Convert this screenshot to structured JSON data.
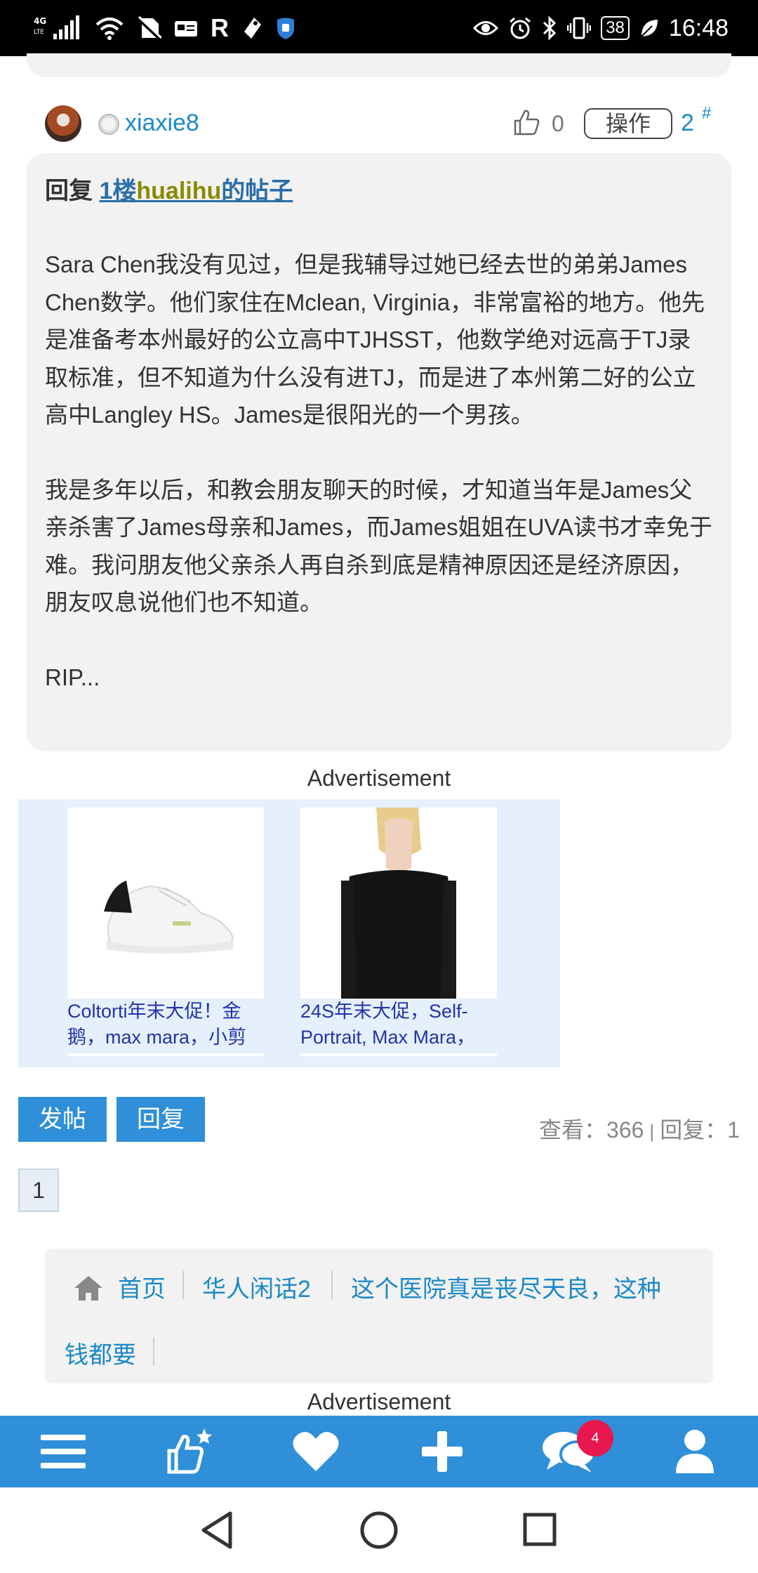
{
  "status_bar": {
    "network": "4G LTE",
    "time": "16:48",
    "battery": "38",
    "r_indicator": "R",
    "icons": [
      "signal-icon",
      "wifi-icon",
      "no-sim-icon",
      "card-icon",
      "r-icon",
      "wrench-icon",
      "shield-icon",
      "eye-icon",
      "alarm-icon",
      "bluetooth-icon",
      "vibrate-icon",
      "battery-icon",
      "leaf-icon"
    ]
  },
  "post": {
    "username": "xiaxie8",
    "like_count": "0",
    "operate_label": "操作",
    "floor": "2",
    "floor_mark": "#",
    "reply_prefix": "回复",
    "reply_link_floor": "1楼",
    "reply_link_user": "hualihu",
    "reply_link_suffix": "的帖子",
    "paragraphs": [
      "Sara Chen我没有见过，但是我辅导过她已经去世的弟弟James Chen数学。他们家住在Mclean, Virginia，非常富裕的地方。他先是准备考本州最好的公立高中TJHSST，他数学绝对远高于TJ录取标准，但不知道为什么没有进TJ，而是进了本州第二好的公立高中Langley HS。James是很阳光的一个男孩。",
      "我是多年以后，和教会朋友聊天的时候，才知道当年是James父亲杀害了James母亲和James，而James姐姐在UVA读书才幸免于难。我问朋友他父亲杀人再自杀到底是精神原因还是经济原因，朋友叹息说他们也不知道。",
      "RIP..."
    ]
  },
  "ads": {
    "label": "Advertisement",
    "items": [
      {
        "title": "Coltorti年末大促！金鹅，max mara，小剪",
        "image": "white-sneaker-image"
      },
      {
        "title": "24S年末大促，Self-Portrait, Max Mara，",
        "image": "black-offshoulder-top-image"
      }
    ]
  },
  "actions": {
    "post_label": "发帖",
    "reply_label": "回复",
    "views_label": "查看：",
    "views": "366",
    "separator": "|",
    "replies_label": "回复：",
    "replies": "1"
  },
  "pagination": {
    "current": "1"
  },
  "breadcrumb": {
    "items": [
      "首页",
      "华人闲话2",
      "这个医院真是丧尽天良，这种",
      "钱都要"
    ]
  },
  "bottom_ad_label": "Advertisement",
  "bottom_nav": {
    "items": [
      "menu-icon",
      "thumbs-up-star-icon",
      "heart-icon",
      "plus-icon",
      "chat-icon",
      "user-icon"
    ],
    "chat_badge": "4"
  },
  "colors": {
    "accent": "#2f8fd8",
    "link": "#1c89c8",
    "card_bg": "#f2f2f2",
    "badge": "#e8174e"
  }
}
